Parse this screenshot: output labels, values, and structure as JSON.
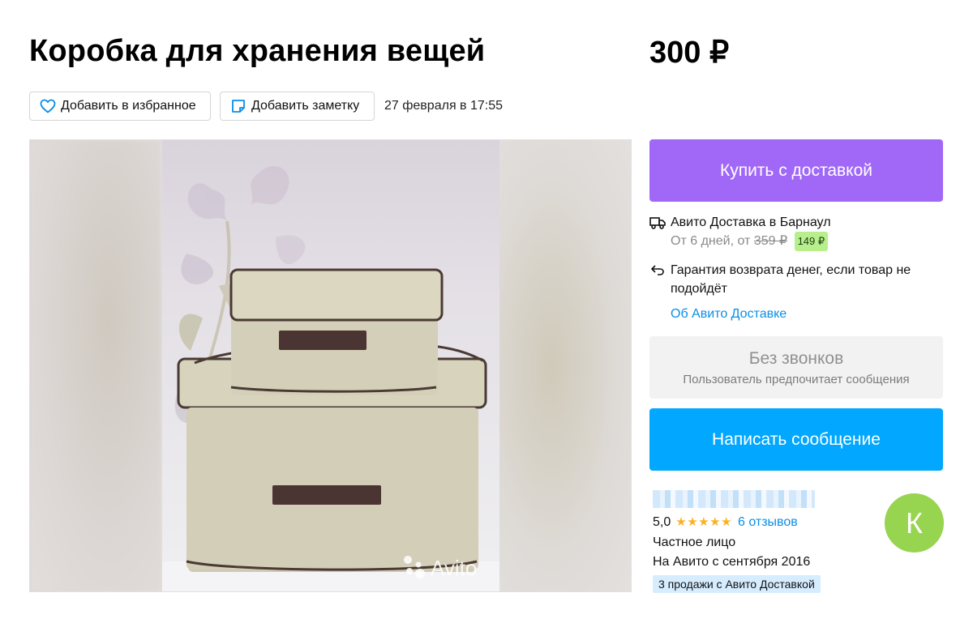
{
  "listing": {
    "title": "Коробка для хранения вещей",
    "price": "300 ₽",
    "date": "27 февраля в 17:55"
  },
  "actions": {
    "favorite_label": "Добавить в избранное",
    "note_label": "Добавить заметку"
  },
  "gallery": {
    "watermark": "Avito",
    "image_alt": "Коробка для хранения вещей"
  },
  "buy": {
    "label": "Купить с доставкой"
  },
  "delivery": {
    "title": "Авито Доставка в Барнаул",
    "terms_prefix": "От 6 дней, от",
    "old_price": "359 ₽",
    "new_price": "149 ₽",
    "guarantee": "Гарантия возврата денег, если товар не подойдёт",
    "about_link": "Об Авито Доставке"
  },
  "contact": {
    "no_calls_title": "Без звонков",
    "no_calls_subtitle": "Пользователь предпочитает сообщения",
    "message_label": "Написать сообщение"
  },
  "seller": {
    "rating": "5,0",
    "stars": "★★★★★",
    "reviews": "6 отзывов",
    "type": "Частное лицо",
    "since": "На Авито с сентября 2016",
    "sales_badge": "3 продажи с Авито Доставкой",
    "avatar_letter": "К"
  },
  "colors": {
    "buy_button": "#a168f8",
    "message_button": "#02a7ff",
    "link": "#0a8ee6",
    "avatar": "#97d44f",
    "price_badge": "#b8ef8d",
    "sales_badge": "#d6edff",
    "stars": "#ffb021"
  }
}
